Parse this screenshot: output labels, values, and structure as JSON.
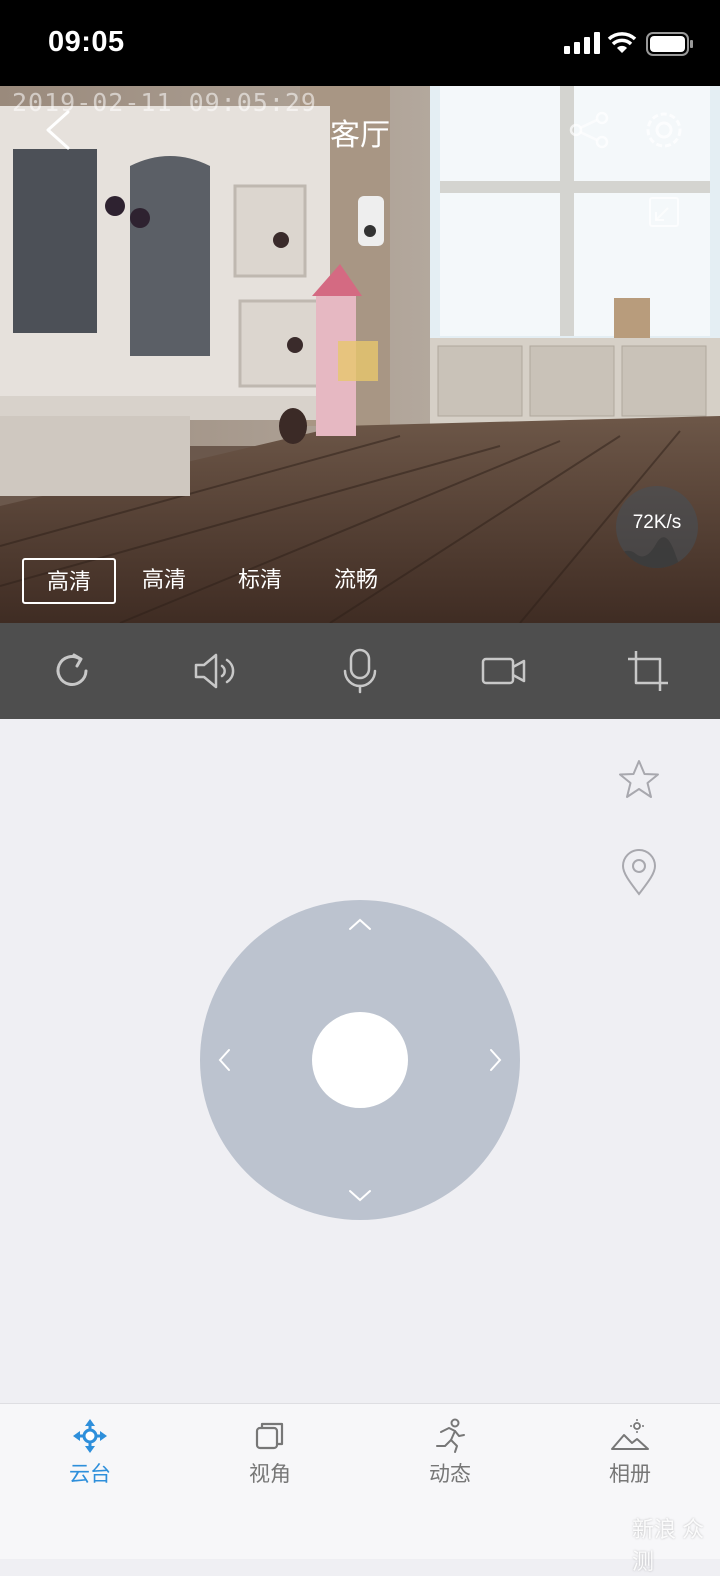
{
  "status_bar": {
    "time": "09:05"
  },
  "video": {
    "timestamp": "2019-02-11 09:05:29",
    "title": "客厅",
    "speed": "72K/s",
    "quality_options": [
      {
        "label": "高清",
        "active": true
      },
      {
        "label": "高清",
        "active": false
      },
      {
        "label": "标清",
        "active": false
      },
      {
        "label": "流畅",
        "active": false
      }
    ]
  },
  "controls": {
    "icons": [
      "refresh-icon",
      "speaker-icon",
      "microphone-icon",
      "record-video-icon",
      "crop-icon"
    ]
  },
  "side_icons": [
    "star-icon",
    "location-pin-icon"
  ],
  "tabs": [
    {
      "label": "云台",
      "icon": "ptz-move-icon",
      "active": true
    },
    {
      "label": "视角",
      "icon": "view-angle-icon",
      "active": false
    },
    {
      "label": "动态",
      "icon": "motion-icon",
      "active": false
    },
    {
      "label": "相册",
      "icon": "album-icon",
      "active": false
    }
  ],
  "watermark": "新浪 众测",
  "colors": {
    "accent": "#2e8fdb",
    "control_bar": "#4e4e4e",
    "joystick": "#bcc3cf"
  }
}
